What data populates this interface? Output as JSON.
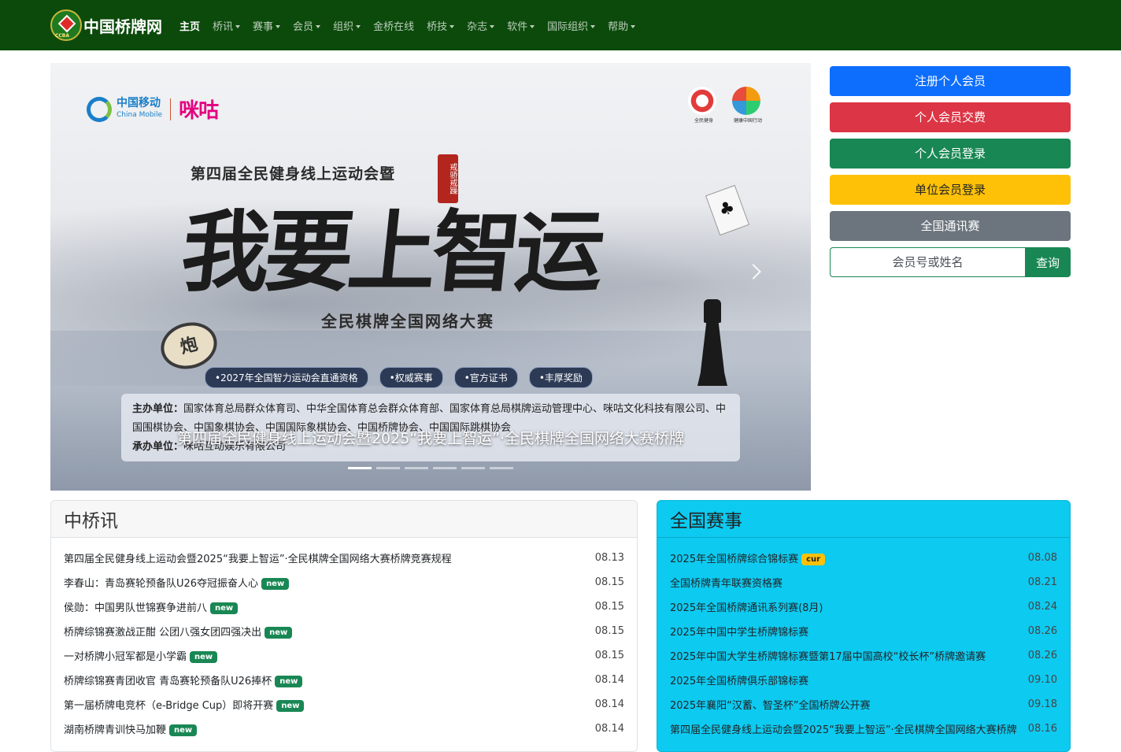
{
  "brand": {
    "name": "中国桥牌网",
    "logo_text": "CCBA"
  },
  "nav": {
    "items": [
      {
        "label": "主页",
        "active": true,
        "dropdown": false
      },
      {
        "label": "桥讯",
        "active": false,
        "dropdown": true
      },
      {
        "label": "赛事",
        "active": false,
        "dropdown": true
      },
      {
        "label": "会员",
        "active": false,
        "dropdown": true
      },
      {
        "label": "组织",
        "active": false,
        "dropdown": true
      },
      {
        "label": "金桥在线",
        "active": false,
        "dropdown": false
      },
      {
        "label": "桥技",
        "active": false,
        "dropdown": true
      },
      {
        "label": "杂志",
        "active": false,
        "dropdown": true
      },
      {
        "label": "软件",
        "active": false,
        "dropdown": true
      },
      {
        "label": "国际组织",
        "active": false,
        "dropdown": true
      },
      {
        "label": "帮助",
        "active": false,
        "dropdown": true
      }
    ]
  },
  "banner": {
    "cm_name": "中国移动",
    "cm_en": "China Mobile",
    "migu": "咪咕",
    "sponsor1": "全民健身",
    "sponsor2": "健康中国行动",
    "subhead": "第四届全民健身线上运动会暨",
    "seal": "戒骄戒躁",
    "big_title": "我要上智运",
    "tagline": "全民棋牌全国网络大赛",
    "pills": [
      "•2027年全国智力运动会直通资格",
      "•权威赛事",
      "•官方证书",
      "•丰厚奖励"
    ],
    "host_label": "主办单位：",
    "host": "国家体育总局群众体育司、中华全国体育总会群众体育部、国家体育总局棋牌运动管理中心、咪咕文化科技有限公司、中国围棋协会、中国象棋协会、中国国际象棋协会、中国桥牌协会、中国国际跳棋协会",
    "organizer_label": "承办单位：",
    "organizer": "咪咕互动娱乐有限公司",
    "xiangqi": "炮",
    "card": "♣",
    "caption": "第四届全民健身线上运动会暨2025“我要上智运”·全民棋牌全国网络大赛桥牌",
    "indicator_count": 6,
    "active_index": 0
  },
  "sidebar": {
    "register": "注册个人会员",
    "pay": "个人会员交费",
    "login_personal": "个人会员登录",
    "login_unit": "单位会员登录",
    "contest": "全国通讯赛",
    "search_placeholder": "会员号或姓名",
    "search_button": "查询"
  },
  "news": {
    "title": "中桥讯",
    "items": [
      {
        "title": "第四届全民健身线上运动会暨2025“我要上智运”·全民棋牌全国网络大赛桥牌竞赛规程",
        "date": "08.13",
        "badge": ""
      },
      {
        "title": "李春山：青岛赛轮预备队U26夺冠振奋人心",
        "date": "08.15",
        "badge": "new"
      },
      {
        "title": "侯勋：中国男队世锦赛争进前八",
        "date": "08.15",
        "badge": "new"
      },
      {
        "title": "桥牌综锦赛激战正酣 公团八强女团四强决出",
        "date": "08.15",
        "badge": "new"
      },
      {
        "title": "一对桥牌小冠军都是小学霸",
        "date": "08.15",
        "badge": "new"
      },
      {
        "title": "桥牌综锦赛青团收官 青岛赛轮预备队U26捧杯",
        "date": "08.14",
        "badge": "new"
      },
      {
        "title": "第一届桥牌电竞杯（e-Bridge Cup）即将开赛",
        "date": "08.14",
        "badge": "new"
      },
      {
        "title": "湖南桥牌青训快马加鞭",
        "date": "08.14",
        "badge": "new"
      }
    ]
  },
  "matches": {
    "title": "全国赛事",
    "items": [
      {
        "title": "2025年全国桥牌综合锦标赛",
        "date": "08.08",
        "badge": "cur"
      },
      {
        "title": "全国桥牌青年联赛资格赛",
        "date": "08.21",
        "badge": ""
      },
      {
        "title": "2025年全国桥牌通讯系列赛(8月)",
        "date": "08.24",
        "badge": ""
      },
      {
        "title": "2025年中国中学生桥牌锦标赛",
        "date": "08.26",
        "badge": ""
      },
      {
        "title": "2025年中国大学生桥牌锦标赛暨第17届中国高校“校长杯”桥牌邀请赛",
        "date": "08.26",
        "badge": ""
      },
      {
        "title": "2025年全国桥牌俱乐部锦标赛",
        "date": "09.10",
        "badge": ""
      },
      {
        "title": "2025年襄阳“汉蓄、智圣杯”全国桥牌公开赛",
        "date": "09.18",
        "badge": ""
      },
      {
        "title": "第四届全民健身线上运动会暨2025“我要上智运”·全民棋牌全国网络大赛桥牌",
        "date": "08.16",
        "badge": ""
      }
    ]
  }
}
